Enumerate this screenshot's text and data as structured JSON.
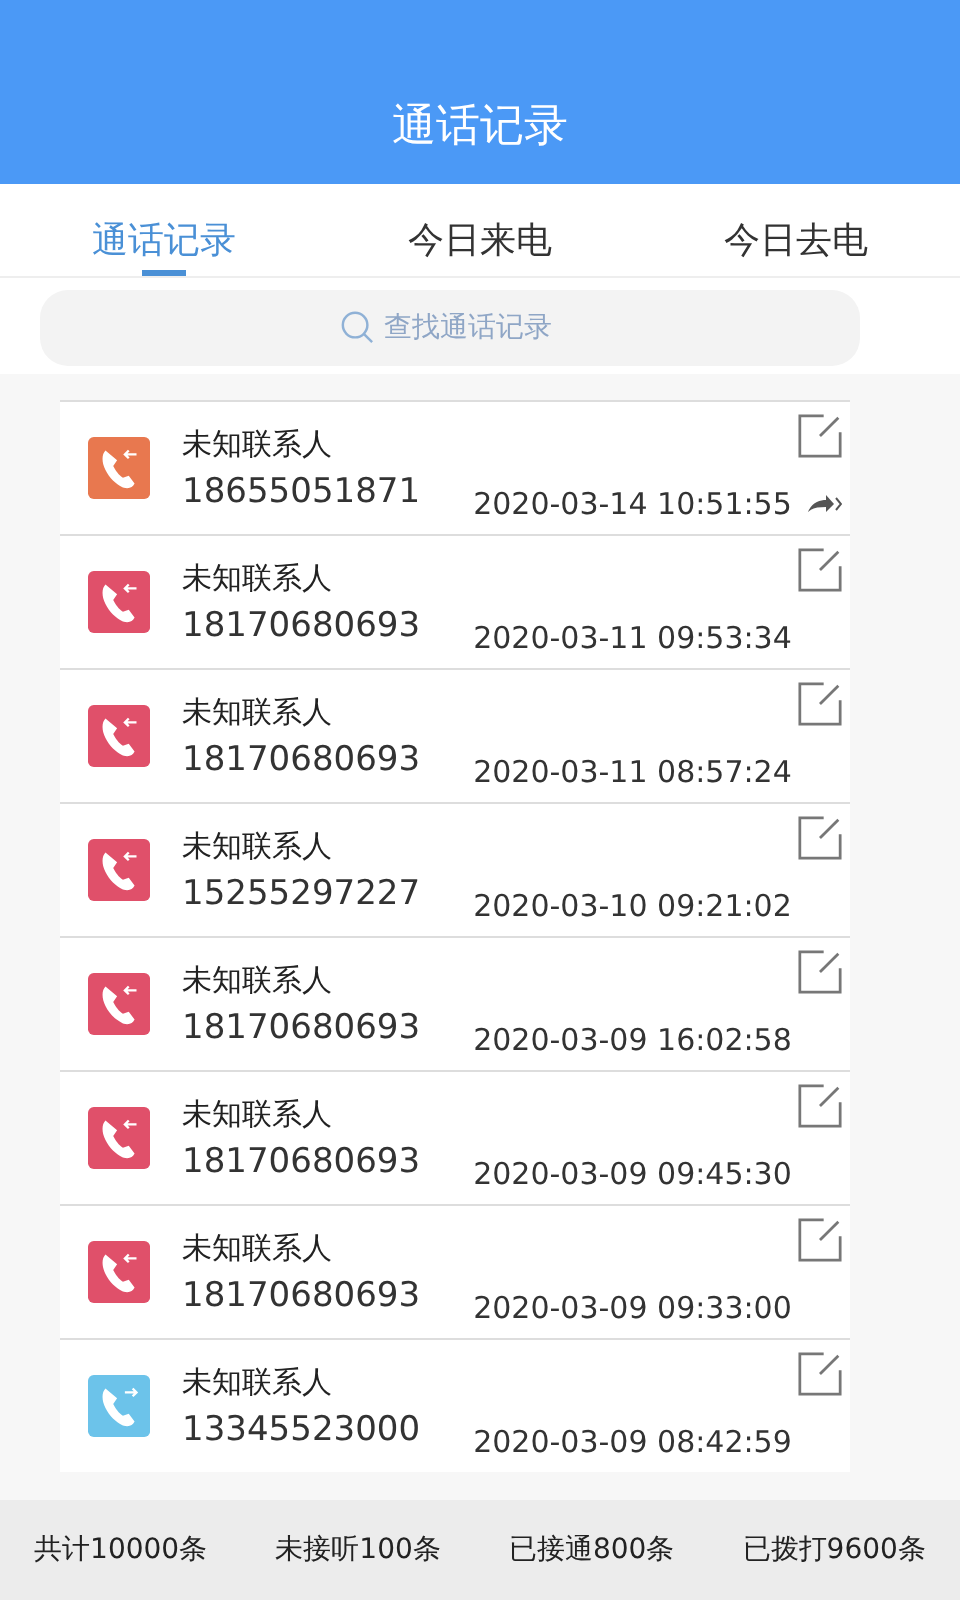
{
  "header": {
    "title": "通话记录"
  },
  "tabs": [
    {
      "label": "通话记录",
      "selected": true
    },
    {
      "label": "今日来电",
      "selected": false
    },
    {
      "label": "今日去电",
      "selected": false
    }
  ],
  "search": {
    "placeholder": "查找通话记录"
  },
  "calls": [
    {
      "kind": "incoming",
      "color": "#e8784f",
      "name": "未知联系人",
      "number": "18655051871",
      "time": "2020-03-14 10:51:55",
      "forwarded": true
    },
    {
      "kind": "missed",
      "color": "#e0506a",
      "name": "未知联系人",
      "number": "18170680693",
      "time": "2020-03-11 09:53:34",
      "forwarded": false
    },
    {
      "kind": "missed",
      "color": "#e0506a",
      "name": "未知联系人",
      "number": "18170680693",
      "time": "2020-03-11 08:57:24",
      "forwarded": false
    },
    {
      "kind": "missed",
      "color": "#e0506a",
      "name": "未知联系人",
      "number": "15255297227",
      "time": "2020-03-10 09:21:02",
      "forwarded": false
    },
    {
      "kind": "missed",
      "color": "#e0506a",
      "name": "未知联系人",
      "number": "18170680693",
      "time": "2020-03-09 16:02:58",
      "forwarded": false
    },
    {
      "kind": "missed",
      "color": "#e0506a",
      "name": "未知联系人",
      "number": "18170680693",
      "time": "2020-03-09 09:45:30",
      "forwarded": false
    },
    {
      "kind": "missed",
      "color": "#e0506a",
      "name": "未知联系人",
      "number": "18170680693",
      "time": "2020-03-09 09:33:00",
      "forwarded": false
    },
    {
      "kind": "outgoing",
      "color": "#6cc3ea",
      "name": "未知联系人",
      "number": "13345523000",
      "time": "2020-03-09 08:42:59",
      "forwarded": false
    }
  ],
  "stats": [
    "共计10000条",
    "未接听100条",
    "已接通800条",
    "已拨打9600条"
  ]
}
